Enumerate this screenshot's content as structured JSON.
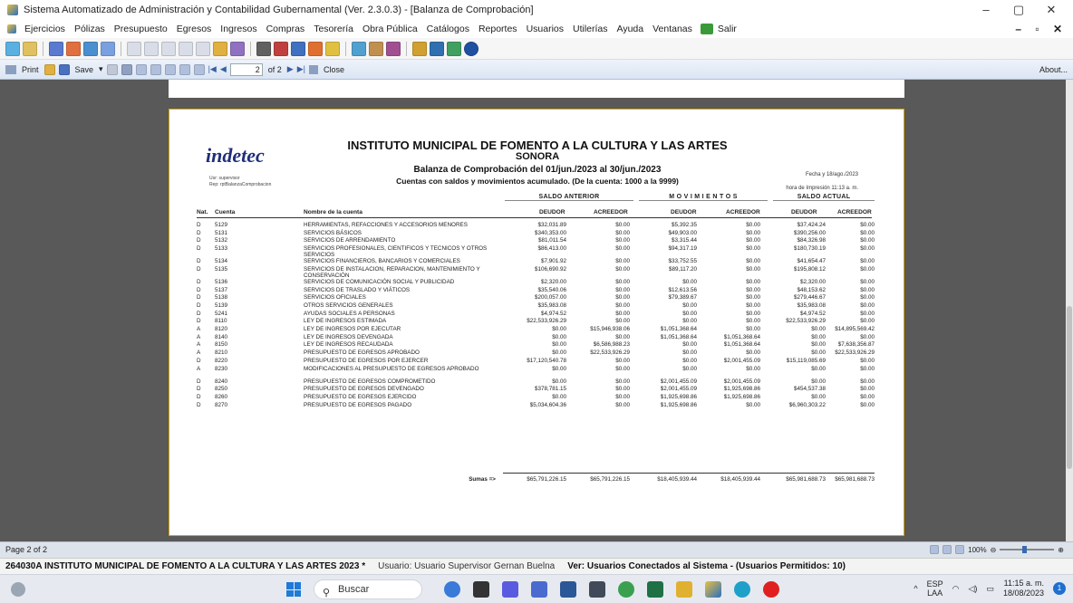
{
  "window": {
    "title": "Sistema Automatizado de Administración y Contabilidad Gubernamental  (Ver. 2.3.0.3) - [Balanza de Comprobación]",
    "controls": [
      "–",
      "▢",
      "✕"
    ]
  },
  "menu": {
    "items": [
      "Ejercicios",
      "Pólizas",
      "Presupuesto",
      "Egresos",
      "Ingresos",
      "Compras",
      "Tesorería",
      "Obra Pública",
      "Catálogos",
      "Reportes",
      "Usuarios",
      "Utilerías",
      "Ayuda",
      "Ventanas",
      "Salir"
    ],
    "right": "– ▫ ✕"
  },
  "viewer_toolbar": {
    "print": "Print",
    "save": "Save",
    "page_value": "2",
    "page_of": "of 2",
    "close": "Close",
    "about": "About..."
  },
  "report": {
    "logo": "indetec",
    "user": "Usr: supervisor",
    "rep": "Rep: rptBalanzaComprobacion",
    "title": "INSTITUTO MUNICIPAL DE FOMENTO A LA CULTURA Y LAS ARTES",
    "subtitle": "SONORA",
    "line3": "Balanza de Comprobación del 01/jun./2023 al 30/jun./2023",
    "line4": "Cuentas con saldos y movimientos acumulado. (De la cuenta: 1000 a la 9999)",
    "fecha": "Fecha y  18/ago./2023",
    "hora": "hora de Impresión  11:13 a. m.",
    "groups": [
      "SALDO ANTERIOR",
      "M O V I M I E N T O S",
      "SALDO ACTUAL"
    ],
    "columns": [
      "Nat.",
      "Cuenta",
      "Nombre de la cuenta",
      "DEUDOR",
      "ACREEDOR",
      "DEUDOR",
      "ACREEDOR",
      "DEUDOR",
      "ACREEDOR"
    ],
    "rows": [
      [
        "D",
        "5129",
        "HERRAMIENTAS, REFACCIONES Y ACCESORIOS MENORES",
        "$32,031.89",
        "$0.00",
        "$5,392.35",
        "$0.00",
        "$37,424.24",
        "$0.00"
      ],
      [
        "D",
        "5131",
        "SERVICIOS BÁSICOS",
        "$340,353.00",
        "$0.00",
        "$49,903.00",
        "$0.00",
        "$390,256.00",
        "$0.00"
      ],
      [
        "D",
        "5132",
        "SERVICIOS DE ARRENDAMIENTO",
        "$81,011.54",
        "$0.00",
        "$3,315.44",
        "$0.00",
        "$84,326.98",
        "$0.00"
      ],
      [
        "D",
        "5133",
        "SERVICIOS PROFESIONALES, CIENTIFICOS Y TECNICOS Y OTROS SERVICIOS",
        "$86,413.00",
        "$0.00",
        "$94,317.19",
        "$0.00",
        "$180,730.19",
        "$0.00"
      ],
      [
        "D",
        "5134",
        "SERVICIOS FINANCIEROS, BANCARIOS Y COMERCIALES",
        "$7,901.92",
        "$0.00",
        "$33,752.55",
        "$0.00",
        "$41,654.47",
        "$0.00"
      ],
      [
        "D",
        "5135",
        "SERVICIOS DE INSTALACION, REPARACION, MANTENIMIENTO Y CONSERVACIÓN",
        "$106,690.92",
        "$0.00",
        "$89,117.20",
        "$0.00",
        "$195,808.12",
        "$0.00"
      ],
      [
        "D",
        "5136",
        "SERVICIOS DE COMUNICACIÓN SOCIAL Y PUBLICIDAD",
        "$2,320.00",
        "$0.00",
        "$0.00",
        "$0.00",
        "$2,320.00",
        "$0.00"
      ],
      [
        "D",
        "5137",
        "SERVICIOS DE TRASLADO Y VIÁTICOS",
        "$35,540.06",
        "$0.00",
        "$12,613.56",
        "$0.00",
        "$48,153.62",
        "$0.00"
      ],
      [
        "D",
        "5138",
        "SERVICIOS OFICIALES",
        "$200,057.00",
        "$0.00",
        "$79,389.67",
        "$0.00",
        "$279,446.67",
        "$0.00"
      ],
      [
        "D",
        "5139",
        "OTROS SERVICIOS GENERALES",
        "$35,983.08",
        "$0.00",
        "$0.00",
        "$0.00",
        "$35,983.08",
        "$0.00"
      ],
      [
        "D",
        "5241",
        "AYUDAS SOCIALES A PERSONAS",
        "$4,974.52",
        "$0.00",
        "$0.00",
        "$0.00",
        "$4,974.52",
        "$0.00"
      ],
      [
        "D",
        "8110",
        "LEY DE INGRESOS ESTIMADA",
        "$22,533,926.29",
        "$0.00",
        "$0.00",
        "$0.00",
        "$22,533,926.29",
        "$0.00"
      ],
      [
        "A",
        "8120",
        "LEY DE INGRESOS POR EJECUTAR",
        "$0.00",
        "$15,946,938.06",
        "$1,051,368.64",
        "$0.00",
        "$0.00",
        "$14,895,569.42"
      ],
      [
        "A",
        "8140",
        "LEY DE INGRESOS DEVENGADA",
        "$0.00",
        "$0.00",
        "$1,051,368.64",
        "$1,051,368.64",
        "$0.00",
        "$0.00"
      ],
      [
        "A",
        "8150",
        "LEY DE INGRESOS RECAUDADA",
        "$0.00",
        "$6,586,988.23",
        "$0.00",
        "$1,051,368.64",
        "$0.00",
        "$7,638,356.87"
      ],
      [
        "A",
        "8210",
        "PRESUPUESTO DE EGRESOS APROBADO",
        "$0.00",
        "$22,533,926.29",
        "$0.00",
        "$0.00",
        "$0.00",
        "$22,533,926.29"
      ],
      [
        "D",
        "8220",
        "PRESUPUESTO DE EGRESOS POR EJERCER",
        "$17,120,540.78",
        "$0.00",
        "$0.00",
        "$2,001,455.09",
        "$15,119,085.69",
        "$0.00"
      ],
      [
        "A",
        "8230",
        "MODIFICACIONES AL PRESUPUESTO DE EGRESOS APROBADO",
        "$0.00",
        "$0.00",
        "$0.00",
        "$0.00",
        "$0.00",
        "$0.00"
      ],
      [
        "D",
        "8240",
        "PRESUPUESTO DE EGRESOS COMPROMETIDO",
        "$0.00",
        "$0.00",
        "$2,001,455.09",
        "$2,001,455.09",
        "$0.00",
        "$0.00"
      ],
      [
        "D",
        "8250",
        "PRESUPUESTO DE EGRESOS DEVENGADO",
        "$378,781.15",
        "$0.00",
        "$2,001,455.09",
        "$1,925,698.86",
        "$454,537.38",
        "$0.00"
      ],
      [
        "D",
        "8260",
        "PRESUPUESTO DE EGRESOS EJERCIDO",
        "$0.00",
        "$0.00",
        "$1,925,698.86",
        "$1,925,698.86",
        "$0.00",
        "$0.00"
      ],
      [
        "D",
        "8270",
        "PRESUPUESTO DE EGRESOS PAGADO",
        "$5,034,604.36",
        "$0.00",
        "$1,925,698.86",
        "$0.00",
        "$6,960,303.22",
        "$0.00"
      ]
    ],
    "sumas_label": "Sumas =>",
    "sumas": [
      "$65,791,226.15",
      "$65,791,226.15",
      "$18,405,939.44",
      "$18,405,939.44",
      "$65,981,688.73",
      "$65,981,688.73"
    ]
  },
  "status": {
    "page": "Page 2 of 2",
    "zoom": "100%"
  },
  "info": {
    "institution": "264030A INSTITUTO MUNICIPAL DE FOMENTO A LA CULTURA Y LAS ARTES  2023  *",
    "user": "Usuario: Usuario Supervisor Gernan Buelna",
    "connected": "Ver: Usuarios Conectados al Sistema - (Usuarios Permitidos: 10)"
  },
  "taskbar": {
    "search": "Buscar",
    "lang1": "ESP",
    "lang2": "LAA",
    "time": "11:15 a. m.",
    "date": "18/08/2023",
    "notif": "1"
  }
}
